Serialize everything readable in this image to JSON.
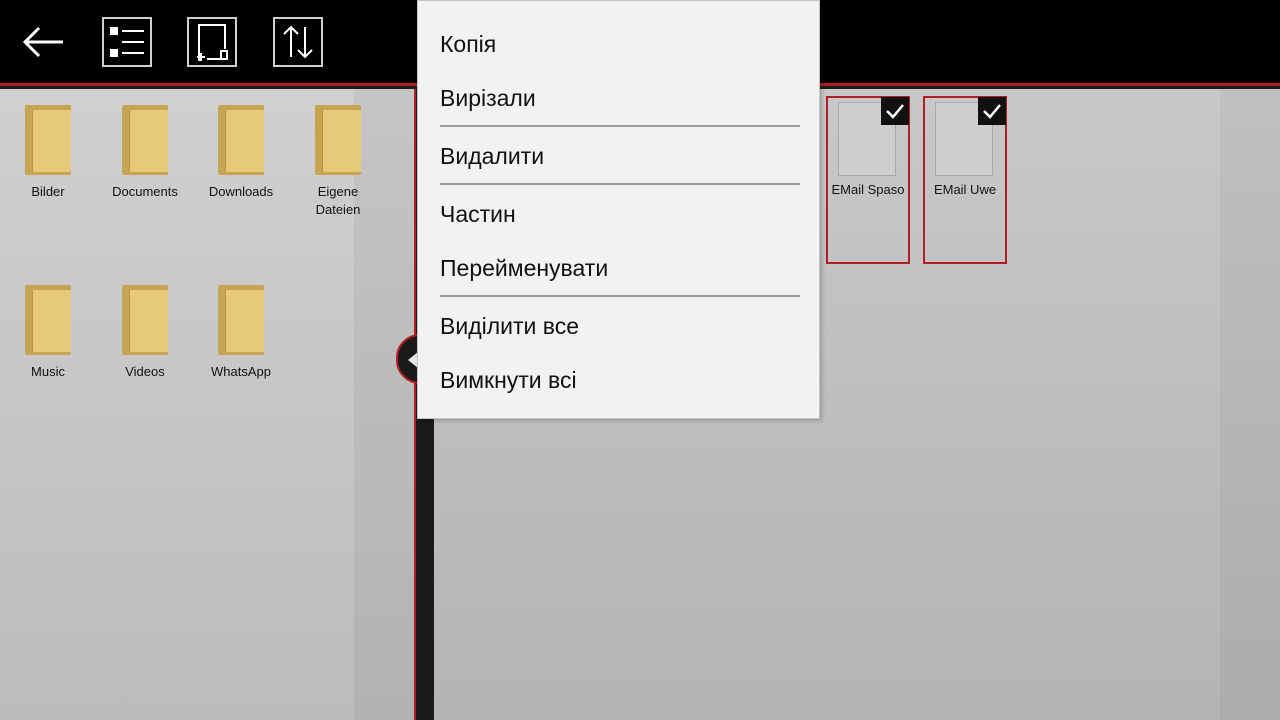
{
  "toolbar": {
    "back_icon": "arrow-left-icon",
    "list_icon": "list-view-icon",
    "new_icon": "new-item-icon",
    "sort_icon": "sort-icon",
    "accent_color": "#b01e23"
  },
  "left_pane": {
    "folders": [
      {
        "label": "Bilder"
      },
      {
        "label": "Documents"
      },
      {
        "label": "Downloads"
      },
      {
        "label": "Eigene Dateien"
      },
      {
        "label": "Music"
      },
      {
        "label": "Videos"
      },
      {
        "label": "WhatsApp"
      }
    ]
  },
  "right_pane": {
    "files": [
      {
        "label": "EMail Spaso",
        "selected": true
      },
      {
        "label": "EMail Uwe",
        "selected": true
      }
    ]
  },
  "context_menu": {
    "copy": "Копія",
    "cut": "Вирізали",
    "delete": "Видалити",
    "share": "Частин",
    "rename": "Перейменувати",
    "select_all": "Виділити все",
    "deselect_all": "Вимкнути всі"
  }
}
